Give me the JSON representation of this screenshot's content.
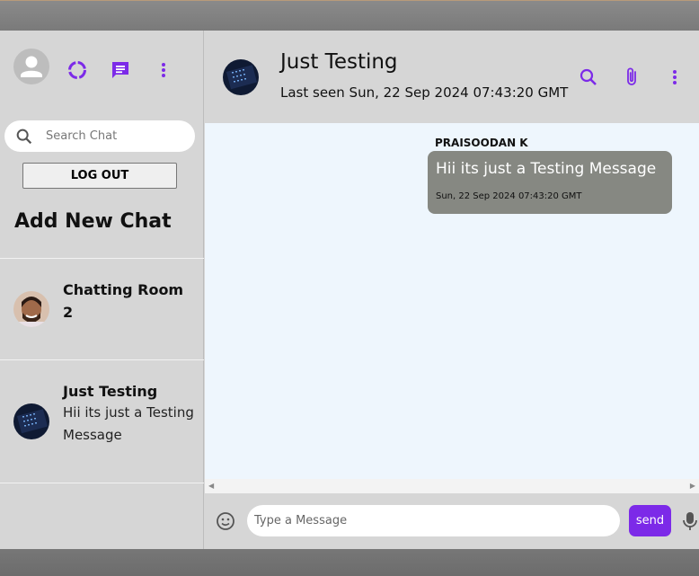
{
  "sidebar": {
    "search_placeholder": "Search Chat",
    "logout_label": "LOG OUT",
    "add_chat_label": "Add New Chat",
    "chats": [
      {
        "name": "Chatting Room 2",
        "preview": ""
      },
      {
        "name": "Just Testing",
        "preview": "Hii its just a Testing Message"
      }
    ]
  },
  "header": {
    "title": "Just Testing",
    "subtitle": "Last seen Sun, 22 Sep 2024 07:43:20 GMT"
  },
  "messages": [
    {
      "sender": "PRAISOODAN K",
      "text": "Hii its just a Testing Message",
      "time": "Sun, 22 Sep 2024 07:43:20 GMT"
    }
  ],
  "composer": {
    "placeholder": "Type a Message",
    "send_label": "send"
  },
  "colors": {
    "accent": "#7c2ae8",
    "bubble": "#868882",
    "chat_bg": "#eef6fd",
    "panel": "#d6d6d6"
  },
  "icons": [
    "person-icon",
    "status-icon",
    "chat-icon",
    "more-vert-icon",
    "search-icon",
    "attach-icon",
    "emoji-icon",
    "mic-icon"
  ]
}
